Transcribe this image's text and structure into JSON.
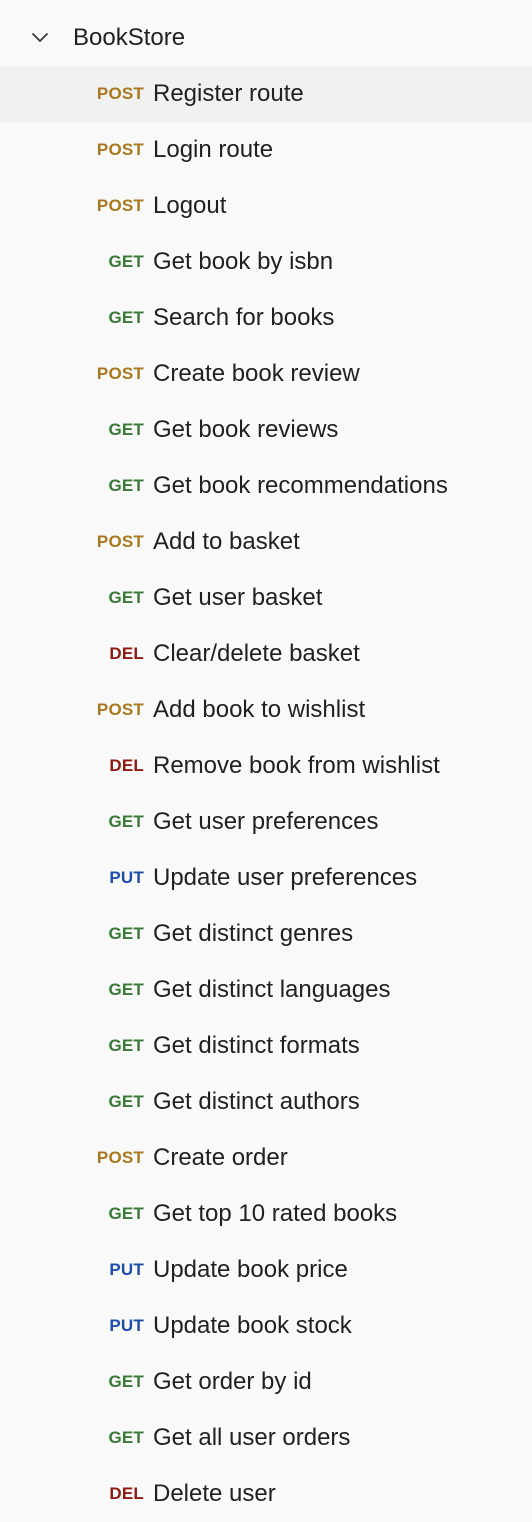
{
  "collection": {
    "name": "BookStore",
    "expanded_icon": "chevron-down-icon"
  },
  "method_colors": {
    "POST": "#a9781e",
    "GET": "#3a7a38",
    "DEL": "#8e1a10",
    "PUT": "#1d4fa8"
  },
  "selected_index": 0,
  "requests": [
    {
      "method": "POST",
      "name": "Register route"
    },
    {
      "method": "POST",
      "name": "Login route"
    },
    {
      "method": "POST",
      "name": "Logout"
    },
    {
      "method": "GET",
      "name": "Get book by isbn"
    },
    {
      "method": "GET",
      "name": "Search for books"
    },
    {
      "method": "POST",
      "name": "Create book review"
    },
    {
      "method": "GET",
      "name": "Get book reviews"
    },
    {
      "method": "GET",
      "name": "Get book recommendations"
    },
    {
      "method": "POST",
      "name": "Add to basket"
    },
    {
      "method": "GET",
      "name": "Get user basket"
    },
    {
      "method": "DEL",
      "name": "Clear/delete basket"
    },
    {
      "method": "POST",
      "name": "Add book to wishlist"
    },
    {
      "method": "DEL",
      "name": "Remove book from wishlist"
    },
    {
      "method": "GET",
      "name": "Get user preferences"
    },
    {
      "method": "PUT",
      "name": "Update user preferences"
    },
    {
      "method": "GET",
      "name": "Get distinct genres"
    },
    {
      "method": "GET",
      "name": "Get distinct languages"
    },
    {
      "method": "GET",
      "name": "Get distinct formats"
    },
    {
      "method": "GET",
      "name": "Get distinct authors"
    },
    {
      "method": "POST",
      "name": "Create order"
    },
    {
      "method": "GET",
      "name": "Get top 10 rated books"
    },
    {
      "method": "PUT",
      "name": "Update book price"
    },
    {
      "method": "PUT",
      "name": "Update book stock"
    },
    {
      "method": "GET",
      "name": "Get order by id"
    },
    {
      "method": "GET",
      "name": "Get all user orders"
    },
    {
      "method": "DEL",
      "name": "Delete user"
    }
  ]
}
